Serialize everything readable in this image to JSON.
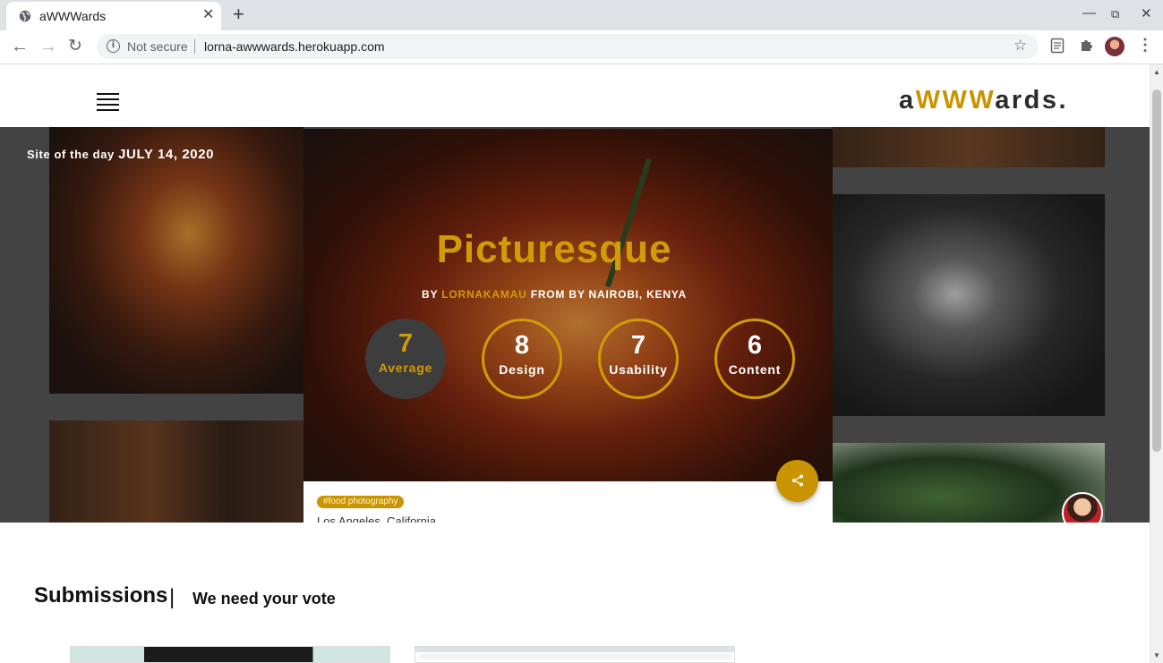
{
  "browser": {
    "tab_title": "aWWWards",
    "tab_close": "✕",
    "new_tab": "+",
    "security_label": "Not secure",
    "url": "lorna-awwwards.herokuapp.com",
    "icons": {
      "back": "arrow-left-icon",
      "forward": "arrow-right-icon",
      "reload": "reload-icon",
      "info": "info-icon",
      "star": "star-icon",
      "menu": "kebab-menu-icon"
    }
  },
  "site": {
    "brand_prefix": "a",
    "brand_highlight": "WWW",
    "brand_suffix": "ards.",
    "accent_color": "#c99400"
  },
  "hero": {
    "sotd_label": "Site of the day",
    "sotd_date": "JULY 14, 2020",
    "title": "Picturesque",
    "by_label": "BY",
    "author": "LORNAKAMAU",
    "from_label": "FROM BY NAIROBI, KENYA",
    "scores": [
      {
        "value": "7",
        "label": "Average"
      },
      {
        "value": "8",
        "label": "Design"
      },
      {
        "value": "7",
        "label": "Usability"
      },
      {
        "value": "6",
        "label": "Content"
      }
    ],
    "tag": "#food photography",
    "location": "Los Angeles, California"
  },
  "submissions": {
    "heading": "Submissions",
    "separator": "|",
    "subheading": "We need your vote"
  }
}
